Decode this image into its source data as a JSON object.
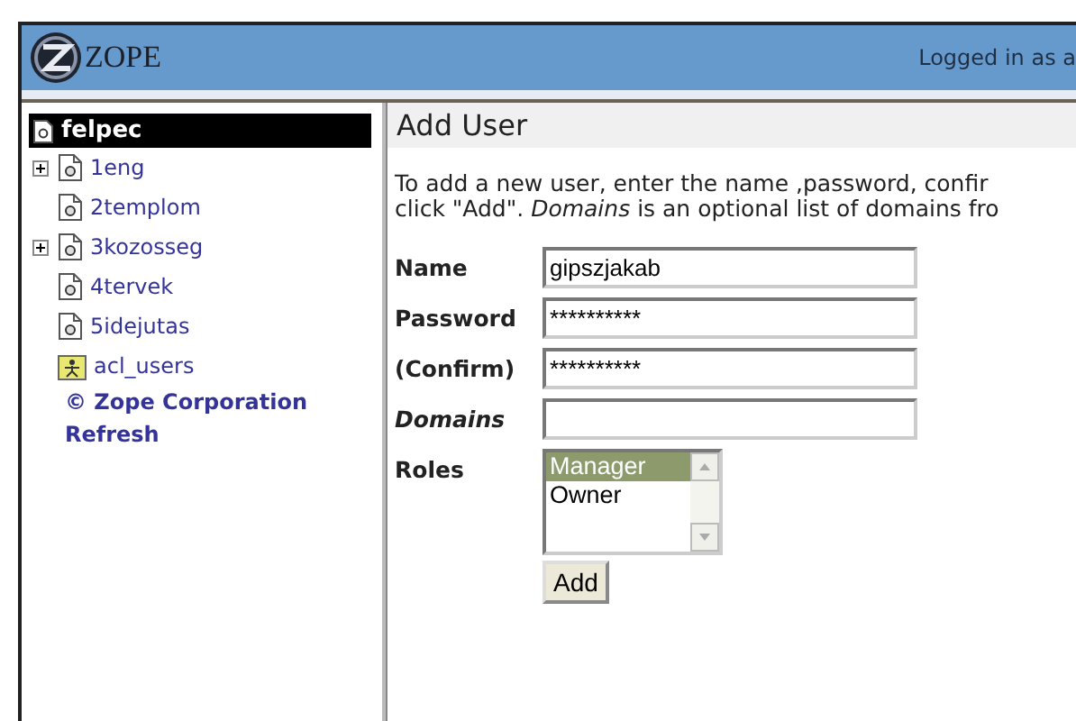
{
  "header": {
    "logo_text": "ZOPE",
    "login": "Logged in as a"
  },
  "tree": {
    "root": {
      "label": "felpec",
      "selected": true
    },
    "items": [
      {
        "label": "1eng",
        "kind": "document",
        "expander": true,
        "selected": false
      },
      {
        "label": "2templom",
        "kind": "document",
        "expander": false,
        "selected": false
      },
      {
        "label": "3kozosseg",
        "kind": "document",
        "expander": true,
        "selected": false
      },
      {
        "label": "4tervek",
        "kind": "document",
        "expander": false,
        "selected": false
      },
      {
        "label": "5idejutas",
        "kind": "document",
        "expander": false,
        "selected": false
      },
      {
        "label": "acl_users",
        "kind": "user-folder",
        "expander": false,
        "selected": false
      }
    ],
    "links": [
      "© Zope Corporation",
      "Refresh"
    ]
  },
  "form": {
    "title": "Add User",
    "intro": [
      "To add a new user, enter the name ,password, confir",
      "click \"Add\". *Domains* is an optional list of domains fro"
    ],
    "fields": [
      {
        "label": "Name",
        "value": "gipszjakab",
        "italic": false
      },
      {
        "label": "Password",
        "value": "**********",
        "italic": false
      },
      {
        "label": "(Confirm)",
        "value": "**********",
        "italic": false
      },
      {
        "label": "Domains",
        "italic": true
      }
    ],
    "roles": {
      "label": "Roles",
      "options": [
        {
          "label": "Manager",
          "selected": true
        },
        {
          "label": "Owner",
          "selected": false
        }
      ]
    },
    "button": "Add"
  }
}
